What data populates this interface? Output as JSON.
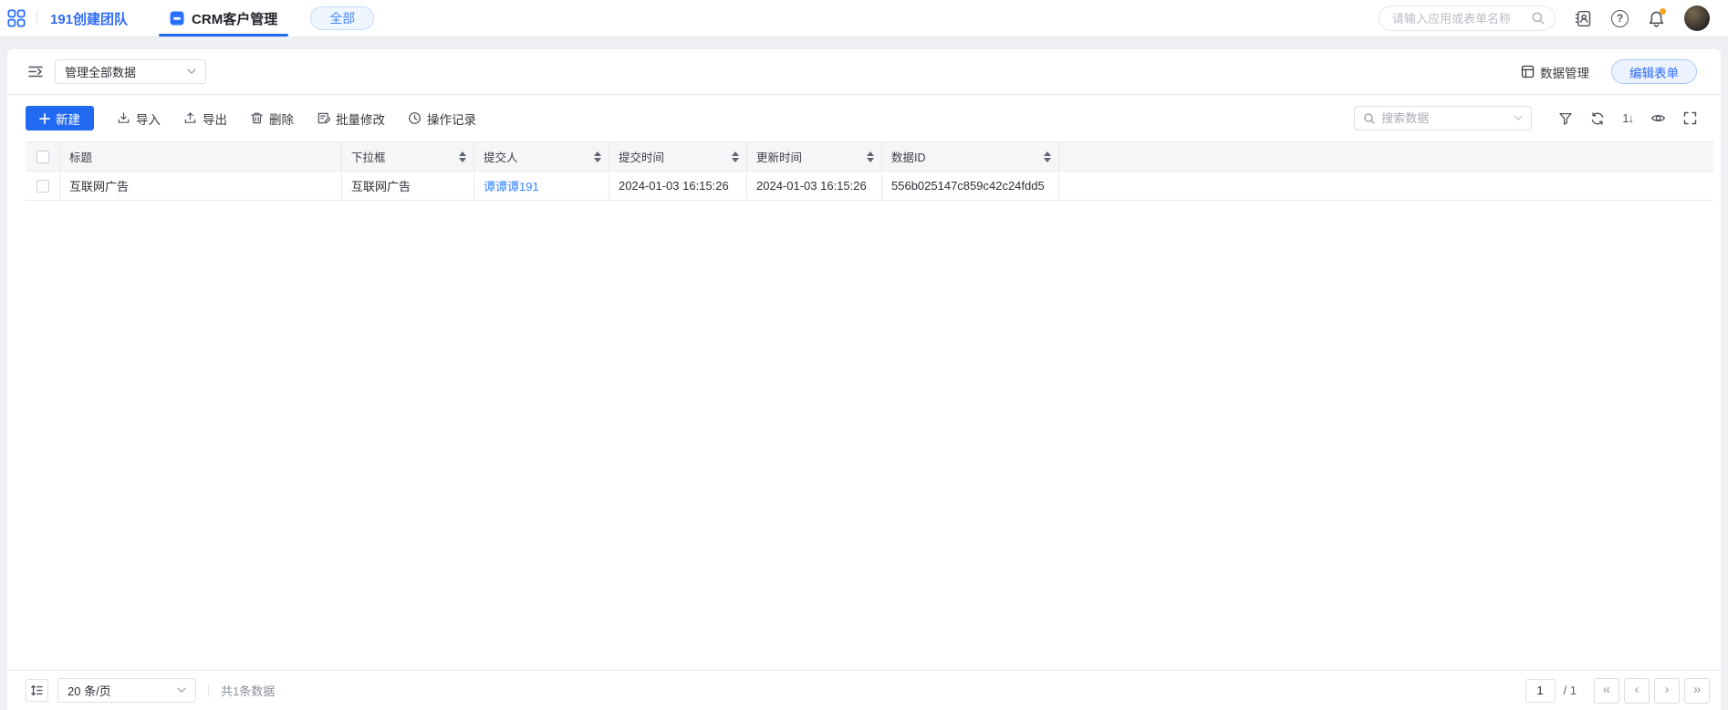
{
  "topbar": {
    "team_name": "191创建团队",
    "tab_label": "CRM客户管理",
    "scope_pill": "全部",
    "search_placeholder": "请输入应用或表单名称"
  },
  "view_bar": {
    "view_selector_value": "管理全部数据",
    "data_manage_label": "数据管理",
    "edit_form_label": "编辑表单"
  },
  "toolbar": {
    "new_label": "新建",
    "import_label": "导入",
    "export_label": "导出",
    "delete_label": "删除",
    "batch_edit_label": "批量修改",
    "history_label": "操作记录",
    "search_placeholder": "搜索数据"
  },
  "table": {
    "columns": [
      {
        "label": "标题",
        "sortable": false
      },
      {
        "label": "下拉框",
        "sortable": true
      },
      {
        "label": "提交人",
        "sortable": true
      },
      {
        "label": "提交时间",
        "sortable": true
      },
      {
        "label": "更新时间",
        "sortable": true
      },
      {
        "label": "数据ID",
        "sortable": true
      }
    ],
    "rows": [
      {
        "cells": [
          "互联网广告",
          "互联网广告",
          "谭谭谭191",
          "2024-01-03 16:15:26",
          "2024-01-03 16:15:26",
          "556b025147c859c42c24fdd5"
        ]
      }
    ]
  },
  "footer": {
    "page_size_value": "20 条/页",
    "total_text": "共1条数据",
    "current_page": "1",
    "total_pages_label": "/ 1"
  },
  "icons": {
    "help": "?",
    "sort_tool": "1↓",
    "pagination_first": "«",
    "pagination_prev": "‹",
    "pagination_next": "›",
    "pagination_last": "»"
  },
  "colors": {
    "accent_blue": "#2269f2",
    "link_blue": "#3385ff",
    "notification_dot": "#f5a623",
    "header_bg": "#f5f6f7",
    "page_bg": "#eef0f3"
  }
}
